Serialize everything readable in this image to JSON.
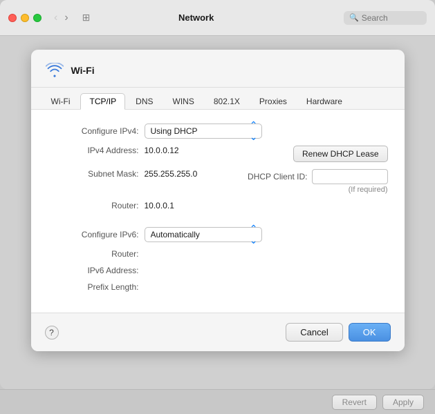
{
  "titlebar": {
    "title": "Network",
    "search_placeholder": "Search"
  },
  "panel": {
    "interface_name": "Wi-Fi",
    "tabs": [
      {
        "label": "Wi-Fi",
        "active": false
      },
      {
        "label": "TCP/IP",
        "active": true
      },
      {
        "label": "DNS",
        "active": false
      },
      {
        "label": "WINS",
        "active": false
      },
      {
        "label": "802.1X",
        "active": false
      },
      {
        "label": "Proxies",
        "active": false
      },
      {
        "label": "Hardware",
        "active": false
      }
    ],
    "form": {
      "configure_ipv4_label": "Configure IPv4:",
      "configure_ipv4_value": "Using DHCP",
      "ipv4_address_label": "IPv4 Address:",
      "ipv4_address_value": "10.0.0.12",
      "subnet_mask_label": "Subnet Mask:",
      "subnet_mask_value": "255.255.255.0",
      "router_label": "Router:",
      "router_value": "10.0.0.1",
      "configure_ipv6_label": "Configure IPv6:",
      "configure_ipv6_value": "Automatically",
      "router6_label": "Router:",
      "router6_value": "",
      "ipv6_address_label": "IPv6 Address:",
      "ipv6_address_value": "",
      "prefix_length_label": "Prefix Length:",
      "prefix_length_value": "",
      "renew_dhcp_label": "Renew DHCP Lease",
      "dhcp_client_id_label": "DHCP Client ID:",
      "dhcp_client_id_value": "",
      "dhcp_hint": "(If required)"
    },
    "footer": {
      "help_label": "?",
      "cancel_label": "Cancel",
      "ok_label": "OK"
    }
  },
  "bottom_bar": {
    "revert_label": "Revert",
    "apply_label": "Apply"
  }
}
